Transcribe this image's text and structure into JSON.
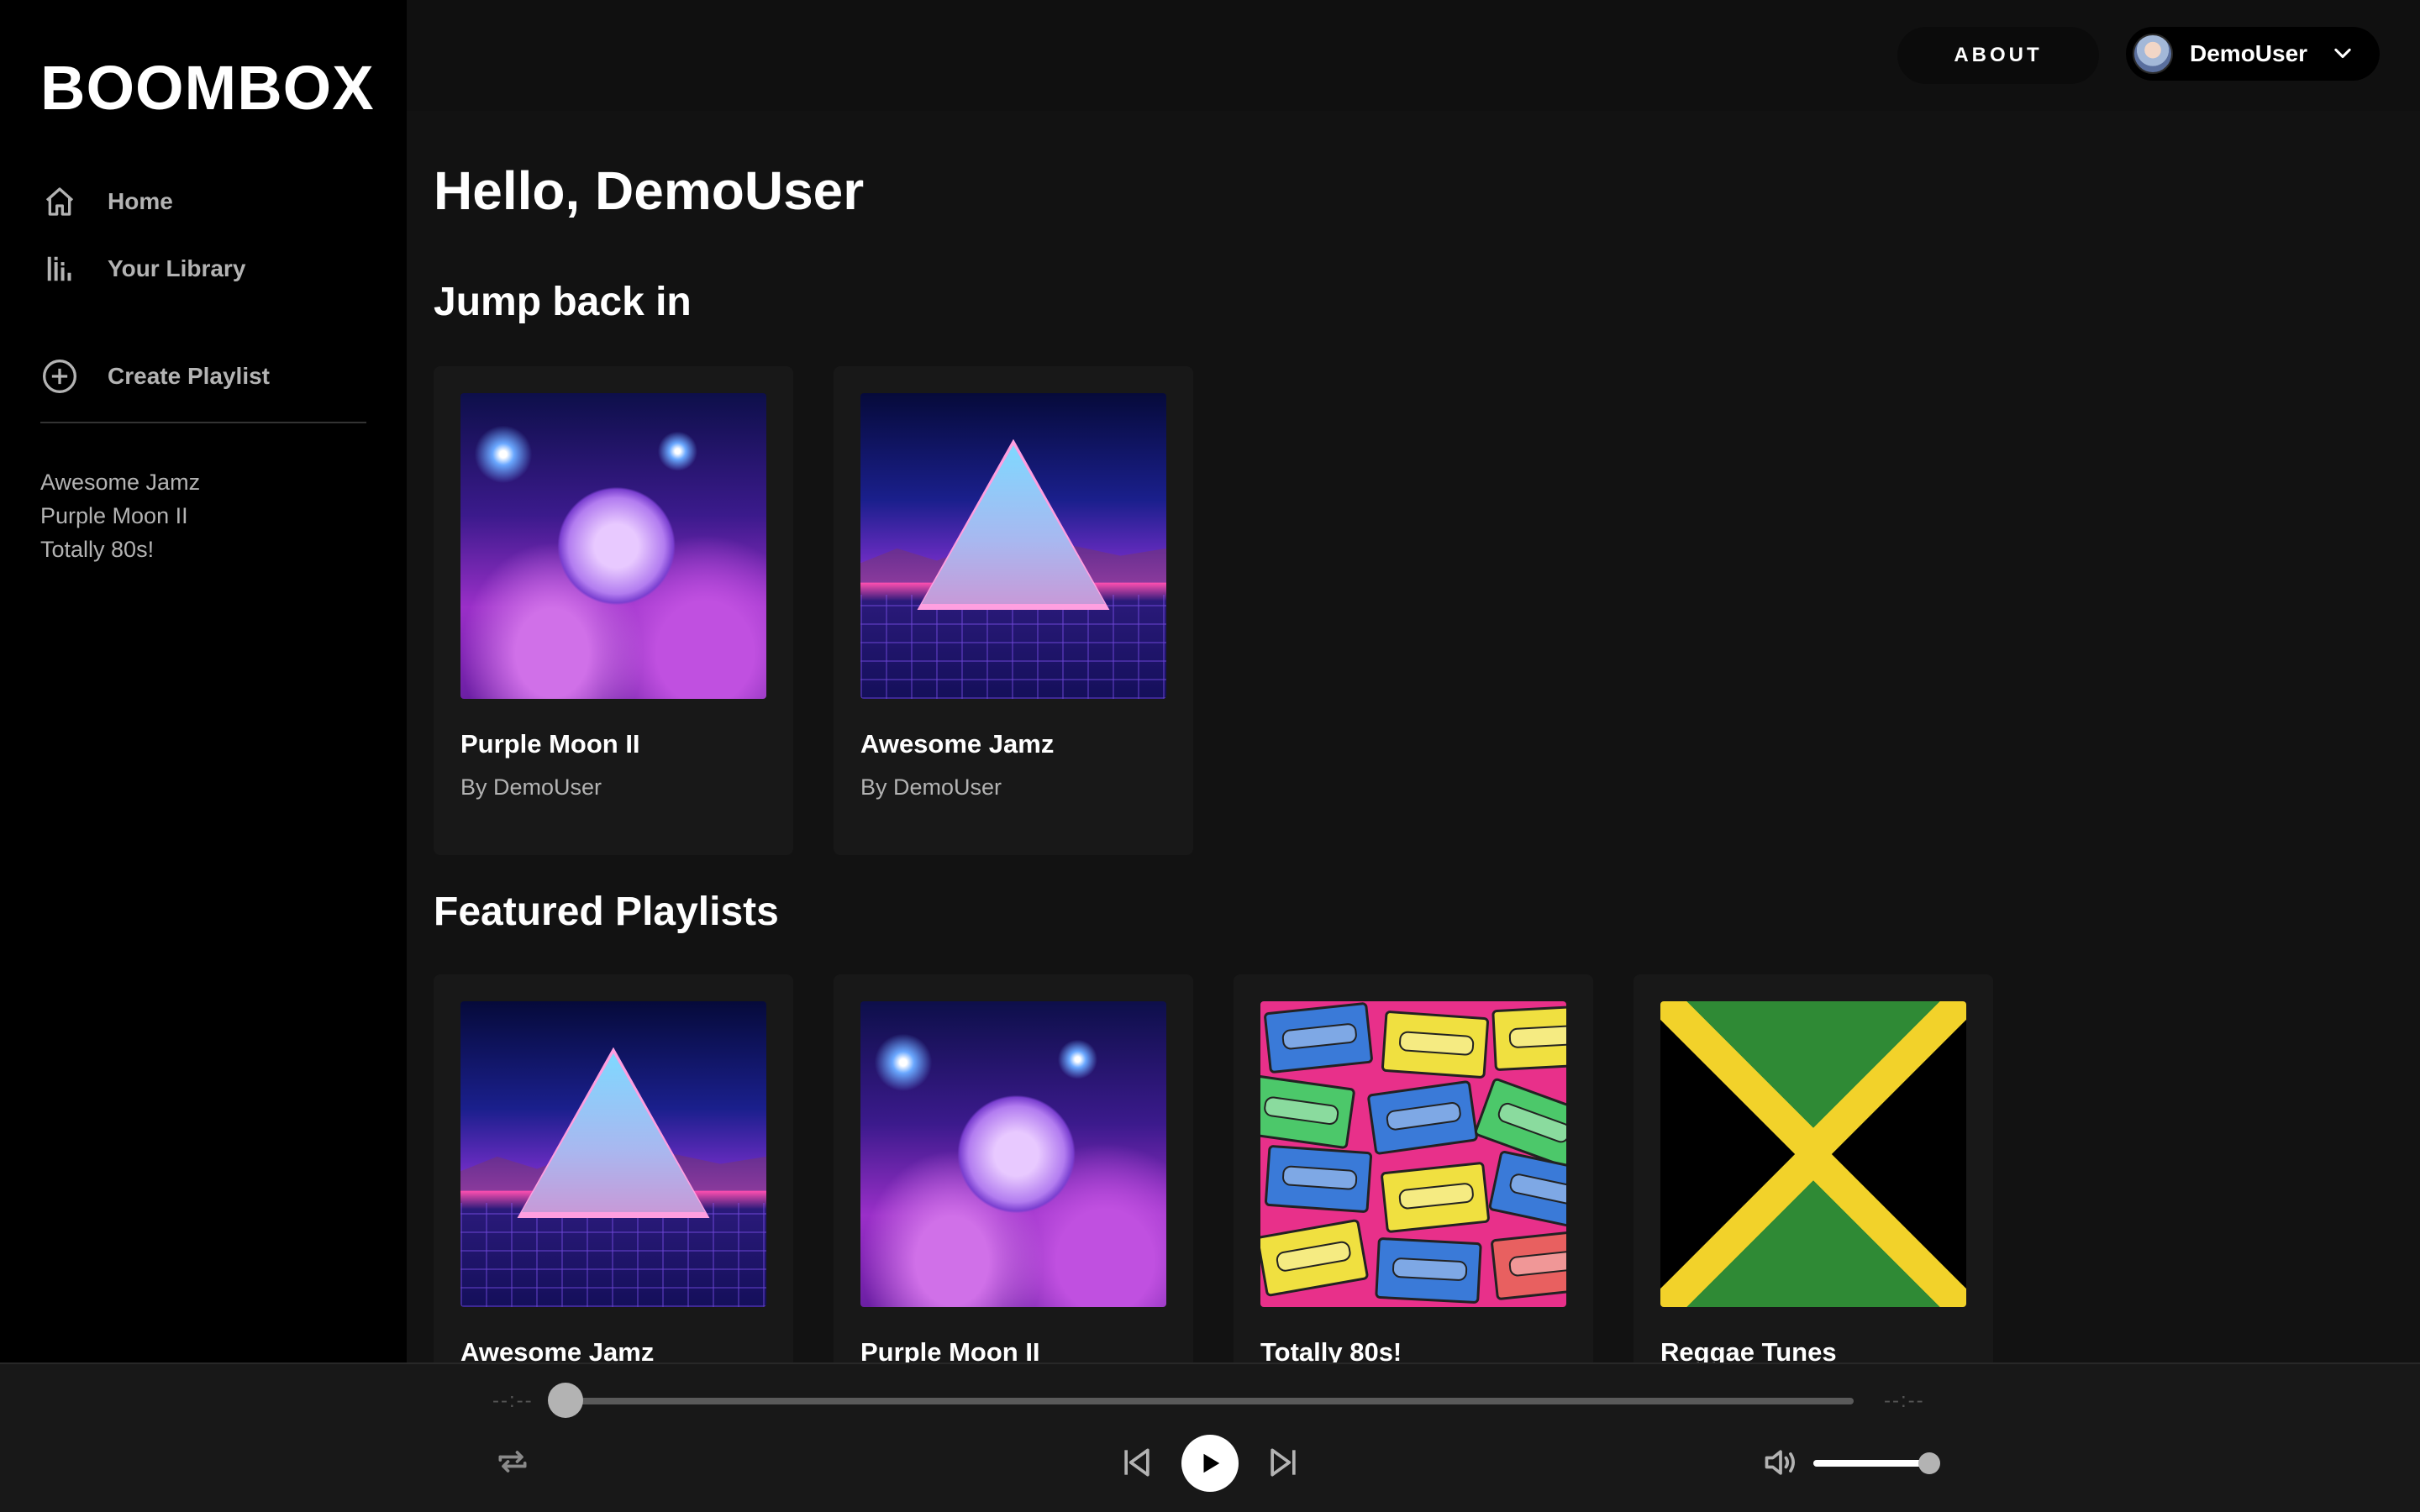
{
  "sidebar": {
    "logo": "BOOMBOX",
    "nav": {
      "home_label": "Home",
      "home_icon": "home-icon",
      "library_label": "Your Library",
      "library_icon": "library-icon",
      "create_label": "Create Playlist",
      "create_icon": "plus-circle-icon"
    },
    "playlists": [
      "Awesome Jamz",
      "Purple Moon II",
      "Totally 80s!"
    ]
  },
  "header": {
    "about_label": "ABOUT",
    "user_name": "DemoUser",
    "dropdown_icon": "chevron-down-icon"
  },
  "main": {
    "greeting": "Hello, DemoUser",
    "jump_back_title": "Jump back in",
    "jump_back": [
      {
        "title": "Purple Moon II",
        "subtitle": "By DemoUser",
        "art": "moon"
      },
      {
        "title": "Awesome Jamz",
        "subtitle": "By DemoUser",
        "art": "triangle"
      }
    ],
    "featured_title": "Featured Playlists",
    "featured": [
      {
        "title": "Awesome Jamz",
        "art": "triangle"
      },
      {
        "title": "Purple Moon II",
        "art": "moon"
      },
      {
        "title": "Totally 80s!",
        "art": "cassette"
      },
      {
        "title": "Reggae Tunes",
        "art": "jamaica"
      }
    ]
  },
  "player": {
    "current_time": "--:--",
    "total_time": "--:--",
    "progress_fraction": 0.0,
    "volume_fraction": 1.0,
    "icons": [
      "repeat-icon",
      "previous-icon",
      "play-icon",
      "next-icon",
      "volume-icon"
    ]
  },
  "colors": {
    "background": "#121212",
    "sidebar": "#000000",
    "card": "#181818",
    "text_secondary": "#b3b3b3"
  }
}
